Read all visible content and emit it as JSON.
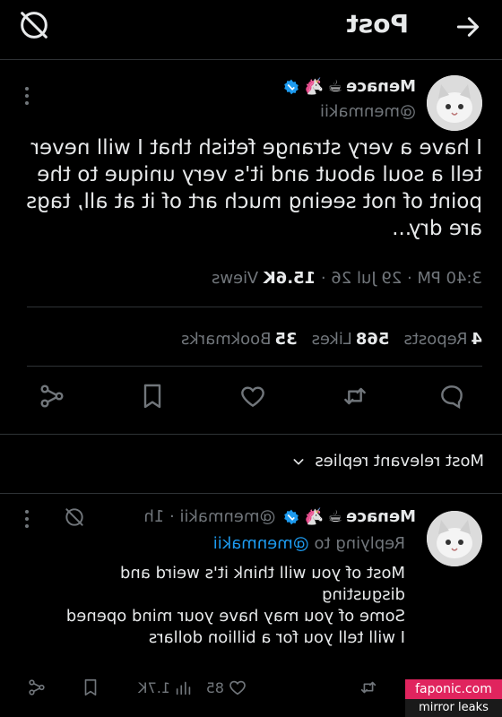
{
  "header": {
    "title": "Post",
    "back_icon": "arrow-left-icon",
    "grok_icon": "grok-icon"
  },
  "post": {
    "display_name": "Menace",
    "emojis": [
      "🦄",
      "☕"
    ],
    "handle": "@menmakii",
    "text": "I have a very strange fetish that I will never tell a soul about and it's very unique to the point of not seeing much art of it at all, tags are dry...",
    "time": "3:40 PM · 29 Jul 26 · ",
    "views_count": "15.6K",
    "views_label": " Views",
    "reposts_count": "4",
    "reposts_label": "Reposts",
    "likes_count": "568",
    "likes_label": "Likes",
    "bookmarks_count": "35",
    "bookmarks_label": "Bookmarks"
  },
  "sort": {
    "label": "Most relevant replies"
  },
  "reply": {
    "display_name": "Menace",
    "emojis": [
      "🦄",
      "☕"
    ],
    "handle_time": "@menmakii · 1h",
    "replying_prefix": "Replying to ",
    "replying_handle": "@menmakii",
    "text_lines": [
      "Most of you will think it's weird and",
      "disgusting",
      "Some of you may have your mind opened",
      "I will tell you for a billion dollars"
    ],
    "likes": "85",
    "views": "1.7K"
  },
  "watermark": {
    "line1": "faponic.com",
    "line2": "mirror leaks"
  },
  "colors": {
    "accent": "#1d9bf0",
    "background": "#000000",
    "muted": "#71767b",
    "text": "#e7e9ea"
  }
}
